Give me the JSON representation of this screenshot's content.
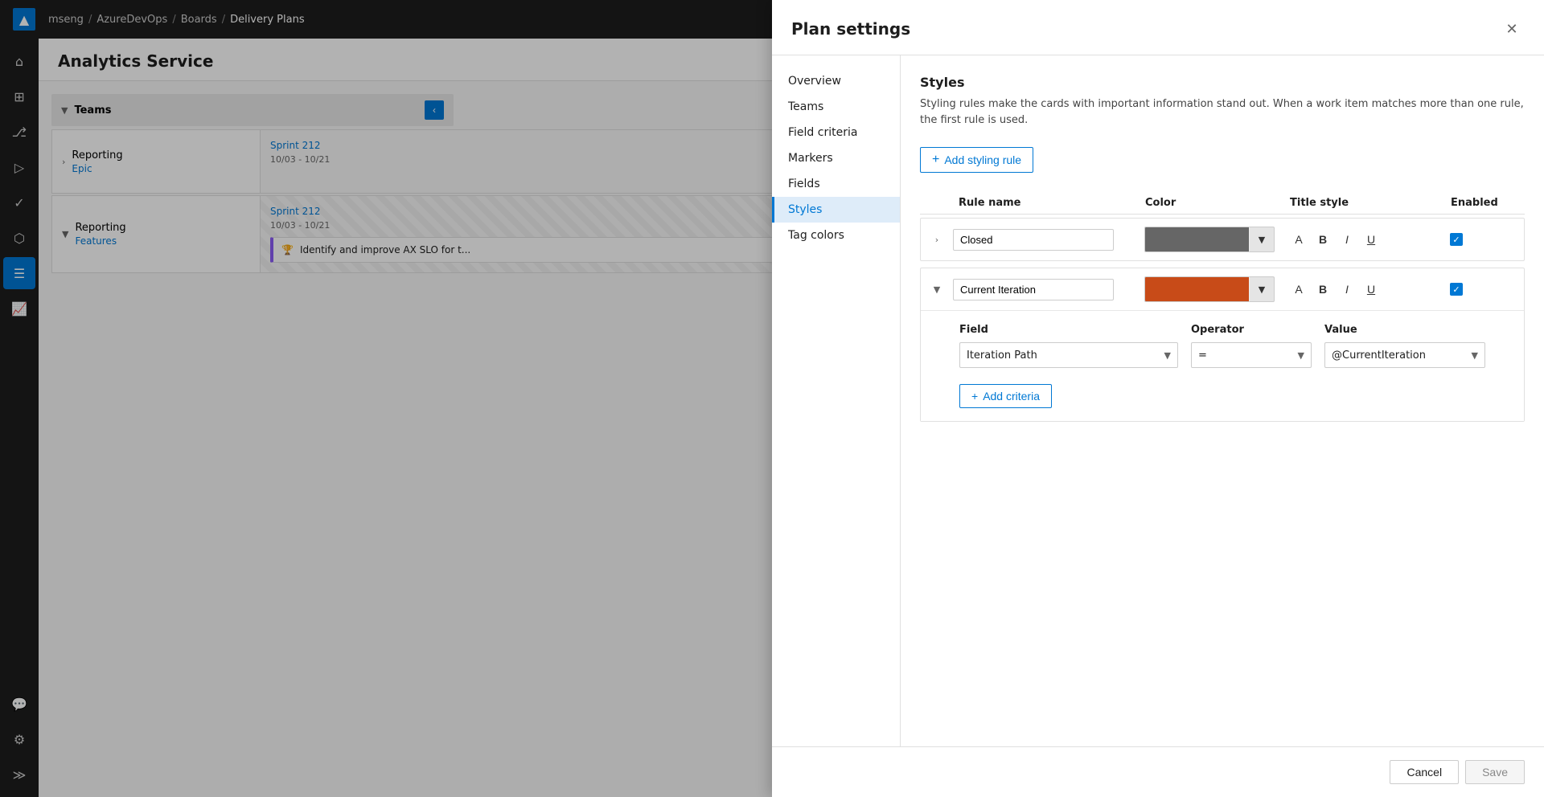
{
  "app": {
    "logo": "▲",
    "nav": {
      "breadcrumbs": [
        "mseng",
        "AzureDevOps",
        "Boards",
        "Delivery Plans"
      ]
    }
  },
  "sidebar": {
    "icons": [
      {
        "name": "home-icon",
        "glyph": "⌂",
        "active": false
      },
      {
        "name": "boards-icon",
        "glyph": "⊞",
        "active": false
      },
      {
        "name": "repos-icon",
        "glyph": "⎇",
        "active": false
      },
      {
        "name": "pipelines-icon",
        "glyph": "▷",
        "active": false
      },
      {
        "name": "test-icon",
        "glyph": "✓",
        "active": false
      },
      {
        "name": "artifacts-icon",
        "glyph": "⬡",
        "active": false
      },
      {
        "name": "plans-icon",
        "glyph": "☰",
        "active": true
      },
      {
        "name": "analytics-icon",
        "glyph": "📈",
        "active": false
      },
      {
        "name": "feedback-icon",
        "glyph": "💬",
        "active": false
      }
    ],
    "bottom_icons": [
      {
        "name": "settings-icon",
        "glyph": "⚙"
      },
      {
        "name": "expand-icon",
        "glyph": "≫"
      }
    ]
  },
  "page": {
    "title": "Analytics Service",
    "teams_label": "Teams",
    "rows": [
      {
        "team": "Reporting",
        "type": "Epic",
        "sprint": "Sprint 212",
        "dates": "10/03 - 10/21"
      },
      {
        "team": "Reporting",
        "type": "Features",
        "sprint": "Sprint 212",
        "dates": "10/03 - 10/21",
        "has_card": true,
        "card_text": "Identify and improve AX SLO for t..."
      }
    ]
  },
  "modal": {
    "title": "Plan settings",
    "nav_items": [
      {
        "label": "Overview",
        "active": false
      },
      {
        "label": "Teams",
        "active": false
      },
      {
        "label": "Field criteria",
        "active": false
      },
      {
        "label": "Markers",
        "active": false
      },
      {
        "label": "Fields",
        "active": false
      },
      {
        "label": "Styles",
        "active": true
      },
      {
        "label": "Tag colors",
        "active": false
      }
    ],
    "content": {
      "title": "Styles",
      "description": "Styling rules make the cards with important information stand out. When a work item matches more than one rule, the first rule is used.",
      "add_rule_label": "Add styling rule",
      "table_headers": {
        "rule_name": "Rule name",
        "color": "Color",
        "title_style": "Title style",
        "enabled": "Enabled"
      },
      "rules": [
        {
          "id": "closed",
          "name": "Closed",
          "color": "#666666",
          "expanded": false,
          "enabled": true
        },
        {
          "id": "current-iteration",
          "name": "Current Iteration",
          "color": "#c84b18",
          "expanded": true,
          "enabled": true,
          "criteria": {
            "field_label": "Field",
            "operator_label": "Operator",
            "value_label": "Value",
            "field_value": "Iteration Path",
            "operator_value": "=",
            "value_value": "@CurrentIteration"
          }
        }
      ],
      "add_criteria_label": "Add criteria",
      "footer": {
        "cancel_label": "Cancel",
        "save_label": "Save"
      }
    }
  }
}
